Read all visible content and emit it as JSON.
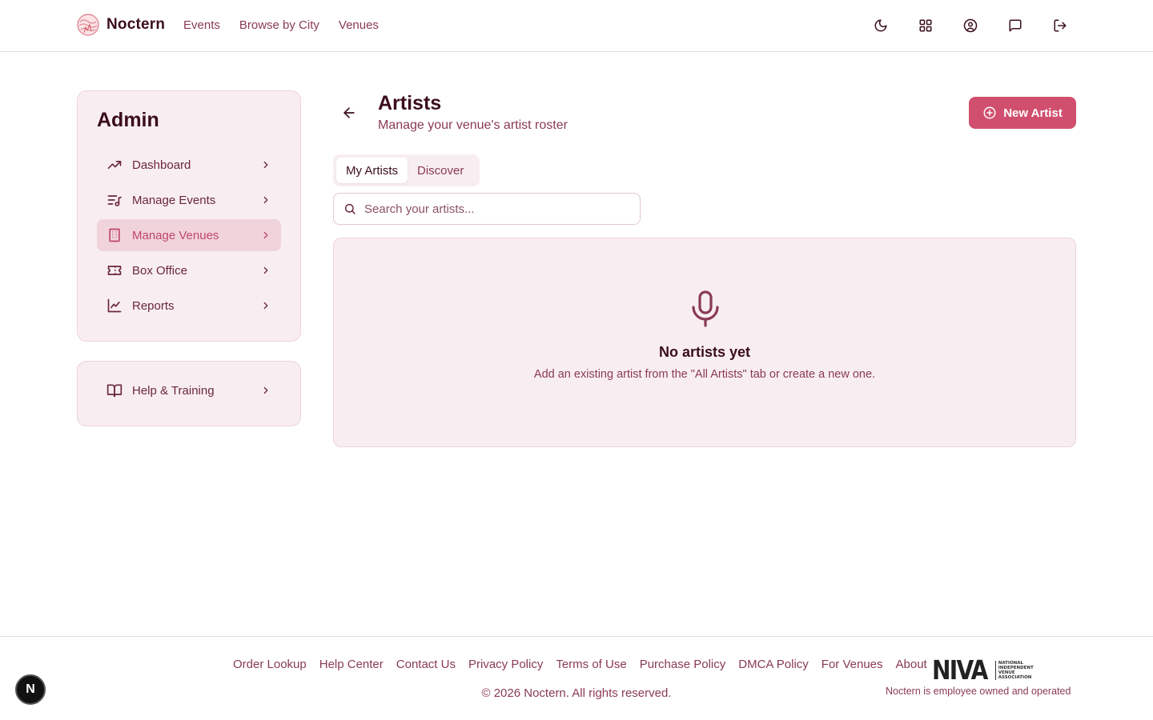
{
  "header": {
    "brand": "Noctern",
    "nav": [
      "Events",
      "Browse by City",
      "Venues"
    ],
    "icons": [
      "moon-icon",
      "apps-grid-icon",
      "user-circle-icon",
      "message-icon",
      "logout-icon"
    ]
  },
  "sidebar": {
    "title": "Admin",
    "items": [
      {
        "label": "Dashboard",
        "icon": "trending-up-icon"
      },
      {
        "label": "Manage Events",
        "icon": "playlist-music-icon"
      },
      {
        "label": "Manage Venues",
        "icon": "building-icon",
        "active": true
      },
      {
        "label": "Box Office",
        "icon": "ticket-icon"
      },
      {
        "label": "Reports",
        "icon": "line-chart-icon"
      }
    ],
    "help": {
      "label": "Help & Training",
      "icon": "book-open-icon"
    }
  },
  "main": {
    "title": "Artists",
    "subtitle": "Manage your venue's artist roster",
    "new_button": "New Artist",
    "tabs": [
      {
        "label": "My Artists",
        "active": true
      },
      {
        "label": "Discover",
        "active": false
      }
    ],
    "search": {
      "placeholder": "Search your artists...",
      "value": ""
    },
    "empty": {
      "title": "No artists yet",
      "description": "Add an existing artist from the \"All Artists\" tab or create a new one."
    }
  },
  "footer": {
    "links": [
      "Order Lookup",
      "Help Center",
      "Contact Us",
      "Privacy Policy",
      "Terms of Use",
      "Purchase Policy",
      "DMCA Policy",
      "For Venues",
      "About"
    ],
    "copyright": "© 2026 Noctern. All rights reserved.",
    "niva": "NIVA",
    "niva_sub": [
      "NATIONAL",
      "INDEPENDENT",
      "VENUE",
      "ASSOCIATION"
    ],
    "tagline": "Noctern is employee owned and operated"
  },
  "dev_badge": "N",
  "colors": {
    "accent": "#d14f6e",
    "text": "#3b0d1e",
    "muted": "#8a3a55",
    "panel": "#f8eef1"
  }
}
